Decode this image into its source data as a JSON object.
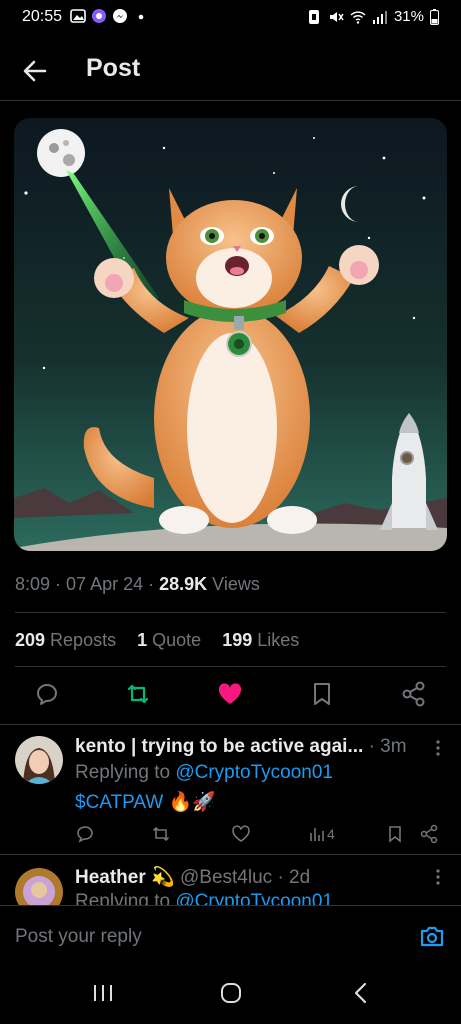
{
  "status_bar": {
    "time": "20:55",
    "battery": "31%"
  },
  "header": {
    "title": "Post"
  },
  "post": {
    "time": "8:09",
    "date": "07 Apr 24",
    "views_count": "28.9K",
    "views_label": "Views",
    "reposts_count": "209",
    "reposts_label": "Reposts",
    "quotes_count": "1",
    "quotes_label": "Quote",
    "likes_count": "199",
    "likes_label": "Likes",
    "liked": true,
    "reposted": true
  },
  "replies": [
    {
      "name": "kento | trying to be active agai...",
      "meta": "· 3m",
      "replying_prefix": "Replying to",
      "replying_handle": "@CryptoTycoon01",
      "text": "$CATPAW",
      "emoji": "🔥🚀",
      "views": "4"
    },
    {
      "name": "Heather",
      "emoji": "💫",
      "handle": "@Best4luc",
      "meta": "· 2d",
      "replying_prefix": "Replying to",
      "replying_handle": "@CryptoTycoon01"
    }
  ],
  "reply_bar": {
    "placeholder": "Post your reply"
  },
  "colors": {
    "accent": "#1d9bf0",
    "like": "#f91880",
    "repost": "#00ba7c",
    "muted": "#71767b"
  },
  "icons": [
    "back-arrow-icon",
    "comment-icon",
    "repost-icon",
    "heart-icon",
    "bookmark-icon",
    "share-icon",
    "camera-icon",
    "more-icon",
    "views-icon"
  ]
}
